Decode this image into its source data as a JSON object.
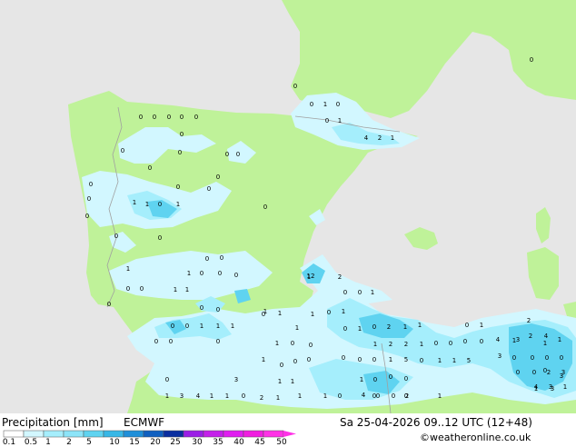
{
  "map": {
    "colors": {
      "sea": "#e6e6e6",
      "land": "#bff299",
      "light_precip": "#d2f7ff",
      "mid_precip": "#a5eefc",
      "heavy_precip": "#5fd3f0"
    },
    "values": [
      {
        "t": "0"
      },
      {
        "t": "0"
      },
      {
        "t": "0"
      },
      {
        "t": "0"
      },
      {
        "t": "0"
      },
      {
        "t": "0"
      },
      {
        "t": "0"
      },
      {
        "t": "0"
      },
      {
        "t": "1"
      },
      {
        "t": "0"
      },
      {
        "t": "0"
      },
      {
        "t": "1"
      },
      {
        "t": "0"
      },
      {
        "t": "0"
      },
      {
        "t": "0"
      },
      {
        "t": "0"
      },
      {
        "t": "0"
      },
      {
        "t": "0"
      },
      {
        "t": "0"
      },
      {
        "t": "1"
      },
      {
        "t": "1"
      },
      {
        "t": "0"
      },
      {
        "t": "1"
      },
      {
        "t": "0"
      },
      {
        "t": "0"
      },
      {
        "t": "0"
      },
      {
        "t": "0"
      },
      {
        "t": "0"
      },
      {
        "t": "0"
      },
      {
        "t": "0"
      },
      {
        "t": "0"
      },
      {
        "t": "1"
      },
      {
        "t": "1"
      },
      {
        "t": "0"
      },
      {
        "t": "0"
      },
      {
        "t": "0"
      },
      {
        "t": "0"
      },
      {
        "t": "1"
      },
      {
        "t": "1"
      },
      {
        "t": "4"
      },
      {
        "t": "2"
      },
      {
        "t": "1"
      },
      {
        "t": "0"
      },
      {
        "t": "0"
      },
      {
        "t": "0"
      },
      {
        "t": "0"
      },
      {
        "t": "1"
      },
      {
        "t": "0"
      },
      {
        "t": "0"
      },
      {
        "t": "0"
      },
      {
        "t": "0"
      },
      {
        "t": "1"
      },
      {
        "t": "1"
      },
      {
        "t": "1"
      },
      {
        "t": "0"
      },
      {
        "t": "0"
      },
      {
        "t": "0"
      },
      {
        "t": "0"
      },
      {
        "t": "12"
      },
      {
        "t": "2"
      },
      {
        "t": "0"
      },
      {
        "t": "0"
      },
      {
        "t": "1"
      },
      {
        "t": "1"
      },
      {
        "t": "1"
      },
      {
        "t": "1"
      },
      {
        "t": "1"
      },
      {
        "t": "0"
      },
      {
        "t": "1"
      },
      {
        "t": "0"
      },
      {
        "t": "1"
      },
      {
        "t": "0"
      },
      {
        "t": "2"
      },
      {
        "t": "1"
      },
      {
        "t": "1"
      },
      {
        "t": "0"
      },
      {
        "t": "0"
      },
      {
        "t": "1"
      },
      {
        "t": "1"
      },
      {
        "t": "0"
      },
      {
        "t": "0"
      },
      {
        "t": "0"
      },
      {
        "t": "0"
      },
      {
        "t": "0"
      },
      {
        "t": "0"
      },
      {
        "t": "1"
      },
      {
        "t": "5"
      },
      {
        "t": "1"
      },
      {
        "t": "2"
      },
      {
        "t": "2"
      },
      {
        "t": "1"
      },
      {
        "t": "0"
      },
      {
        "t": "0"
      },
      {
        "t": "0"
      },
      {
        "t": "0"
      },
      {
        "t": "0"
      },
      {
        "t": "1"
      },
      {
        "t": "4"
      },
      {
        "t": "2"
      },
      {
        "t": "3"
      },
      {
        "t": "1"
      },
      {
        "t": "1"
      },
      {
        "t": "1"
      },
      {
        "t": "0"
      },
      {
        "t": "0"
      },
      {
        "t": "0"
      },
      {
        "t": "0"
      },
      {
        "t": "1"
      },
      {
        "t": "1"
      },
      {
        "t": "5"
      },
      {
        "t": "0"
      },
      {
        "t": "1"
      },
      {
        "t": "0"
      },
      {
        "t": "4"
      },
      {
        "t": "0"
      },
      {
        "t": "0"
      },
      {
        "t": "0"
      },
      {
        "t": "1"
      },
      {
        "t": "1"
      },
      {
        "t": "3"
      },
      {
        "t": "4"
      },
      {
        "t": "1"
      },
      {
        "t": "1"
      },
      {
        "t": "0"
      },
      {
        "t": "2"
      },
      {
        "t": "1"
      },
      {
        "t": "1"
      },
      {
        "t": "0"
      },
      {
        "t": "2"
      },
      {
        "t": "0"
      },
      {
        "t": "0"
      },
      {
        "t": "0"
      },
      {
        "t": "0"
      },
      {
        "t": "1"
      },
      {
        "t": "1"
      },
      {
        "t": "2"
      },
      {
        "t": "4"
      },
      {
        "t": "3"
      },
      {
        "t": "0"
      },
      {
        "t": "0"
      },
      {
        "t": "0"
      },
      {
        "t": "2"
      },
      {
        "t": "3"
      },
      {
        "t": "4"
      },
      {
        "t": "3"
      },
      {
        "t": "1"
      },
      {
        "t": "3"
      },
      {
        "t": "1"
      },
      {
        "t": "3"
      },
      {
        "t": "3"
      },
      {
        "t": "1"
      },
      {
        "t": "3"
      },
      {
        "t": "3"
      },
      {
        "t": "3"
      },
      {
        "t": "5"
      },
      {
        "t": "1"
      },
      {
        "t": "1"
      },
      {
        "t": "3"
      },
      {
        "t": "0"
      }
    ]
  },
  "footer": {
    "title": "Precipitation [mm]",
    "model": "ECMWF",
    "valid_time": "Sa 25-04-2026 09..12 UTC (12+48)",
    "copyright": "©weatheronline.co.uk"
  },
  "legend": {
    "ticks": [
      "0.1",
      "0.5",
      "1",
      "2",
      "5",
      "10",
      "15",
      "20",
      "25",
      "30",
      "35",
      "40",
      "45",
      "50"
    ],
    "colors": [
      "#ffffff",
      "#d2f7ff",
      "#a5eefc",
      "#8ce4f8",
      "#5fd3f0",
      "#37b7e6",
      "#1f8fd9",
      "#1060c0",
      "#0a2ea0",
      "#9b1ee6",
      "#c41fea",
      "#e01ef0",
      "#f01ee0",
      "#ff31e6"
    ]
  }
}
